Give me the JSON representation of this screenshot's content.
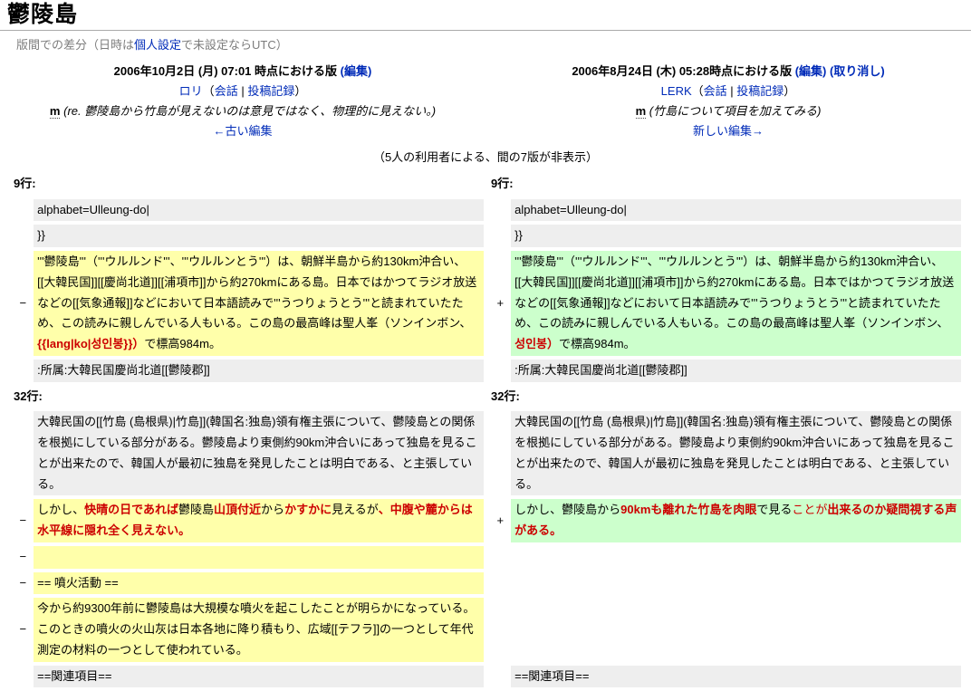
{
  "page": {
    "title": "鬱陵島",
    "subtitle_prefix": "版間での差分（日時は",
    "subtitle_link": "個人設定",
    "subtitle_suffix": "で未設定ならUTC）"
  },
  "old_version": {
    "date": "2006年10月2日 (月) 07:01 時点における版 ",
    "edit_link": "(編集)",
    "user": "ロリ",
    "paren_open": "（",
    "talk": "会話",
    "sep": " | ",
    "contribs": "投稿記録",
    "paren_close": "）",
    "minor": "m",
    "comment": "(re. 鬱陵島から竹島が見えないのは意見ではなく、物理的に見えない。)",
    "nav": "←古い編集"
  },
  "new_version": {
    "date": "2006年8月24日 (木) 05:28時点における版 ",
    "edit_link": "(編集)",
    "undo_link": "(取り消し)",
    "user": "LERK",
    "paren_open": "（",
    "talk": "会話",
    "sep": " | ",
    "contribs": "投稿記録",
    "paren_close": "）",
    "minor": "m",
    "comment": "(竹島について項目を加えてみる)",
    "nav": "新しい編集→"
  },
  "hidden_note": "（5人の利用者による、間の7版が非表示）",
  "colors": {
    "link_blue": "#002bb8",
    "diff_change_red": "#cc0000",
    "deleted_bg": "#ffffaa",
    "added_bg": "#ccffcc",
    "context_bg": "#eeeeee",
    "subtitle_gray": "#7d7d7d"
  },
  "diff": {
    "minus": "−",
    "plus": "+",
    "lineno9": "9行:",
    "lineno32": "32行:",
    "ctx_alphabet": "alphabet=Ulleung-do|",
    "ctx_braces": "}}",
    "ctx_belong": ":所属:大韓民国慶尚北道[[鬱陵郡]]",
    "island": {
      "pre": "'''鬱陵島'''（'''ウルルンド'''、'''ウルルンとう'''）は、朝鮮半島から約130km沖合い、[[大韓民国]][[慶尚北道]][[浦項市]]から約270kmにある島。日本ではかつてラジオ放送などの[[気象通報]]などにおいて日本語読みで'''うつりょうとう'''と読まれていたため、この読みに親しんでいる人もいる。この島の最高峰は聖人峯（ソンインボン、",
      "left_red": "{{lang|ko|성인봉}}）",
      "right_red": "성인봉）",
      "post": "で標高984m。"
    },
    "ctx_takeshima": "大韓民国の[[竹島 (島根県)|竹島]](韓国名:独島)領有権主張について、鬱陵島との関係を根拠にしている部分がある。鬱陵島より東側約90km沖合いにあって独島を見ることが出来たので、韓国人が最初に独島を発見したことは明白である、と主張している。",
    "sight_left": {
      "s0": "しかし、",
      "s1": "快晴の日であれば",
      "s2": "鬱陵島",
      "s3": "山頂付近",
      "s4": "から",
      "s5": "かすかに",
      "s6": "見えるが",
      "s7": "、中腹や麓からは水平線に隠れ全く見えない。"
    },
    "sight_right": {
      "s0": "しかし、鬱陵島から",
      "s1": "90kmも離れた竹島を肉眼",
      "s2": "で見る",
      "s3": "ことが",
      "s4": "出来るのか疑問視する声がある。"
    },
    "empty_line": "",
    "funka_heading": "== 噴火活動 ==",
    "funka_para": "今から約9300年前に鬱陵島は大規模な噴火を起こしたことが明らかになっている。このときの噴火の火山灰は日本各地に降り積もり、広域[[テフラ]]の一つとして年代測定の材料の一つとして使われている。",
    "ctx_related": "==関連項目=="
  }
}
